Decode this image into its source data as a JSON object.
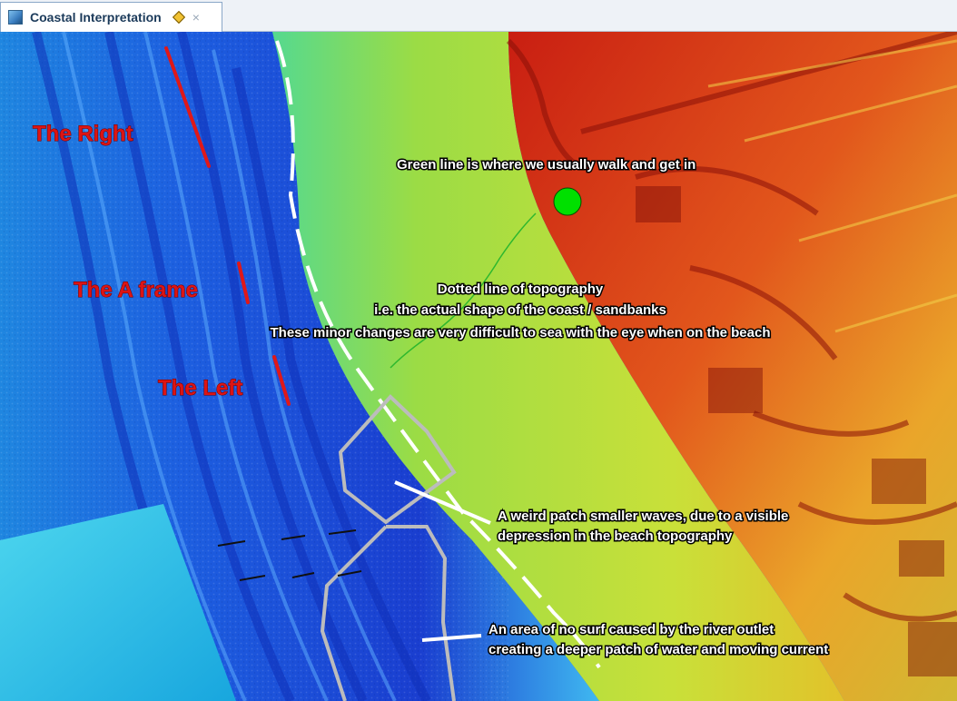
{
  "tab": {
    "title": "Coastal Interpretation",
    "close_glyph": "×"
  },
  "icons": [
    "map-document-icon",
    "pin-icon",
    "close-icon"
  ],
  "colors": {
    "deep_water": "#1d3fd6",
    "shallow_water": "#22c3ef",
    "beach": "#c3df3a",
    "land_high": "#d83a16",
    "annotation_red": "#dc1414",
    "marker_green": "#00e000",
    "annotation_white": "#ffffff"
  },
  "map": {
    "wave_labels": {
      "right": "The Right",
      "a_frame": "The A frame",
      "left": "The Left"
    },
    "notes": {
      "green_line": "Green line is where we usually walk and get in",
      "topo_1": "Dotted line of topography",
      "topo_2": "i.e. the actual shape of the coast / sandbanks",
      "topo_3": "These minor changes are very difficult to sea with the eye when on the beach",
      "patch_1": "A weird patch smaller waves, due to a visible",
      "patch_2": "depression in the beach topography",
      "river_1": "An area of no surf caused by the river outlet",
      "river_2": "creating a deeper patch of water and moving current"
    }
  }
}
